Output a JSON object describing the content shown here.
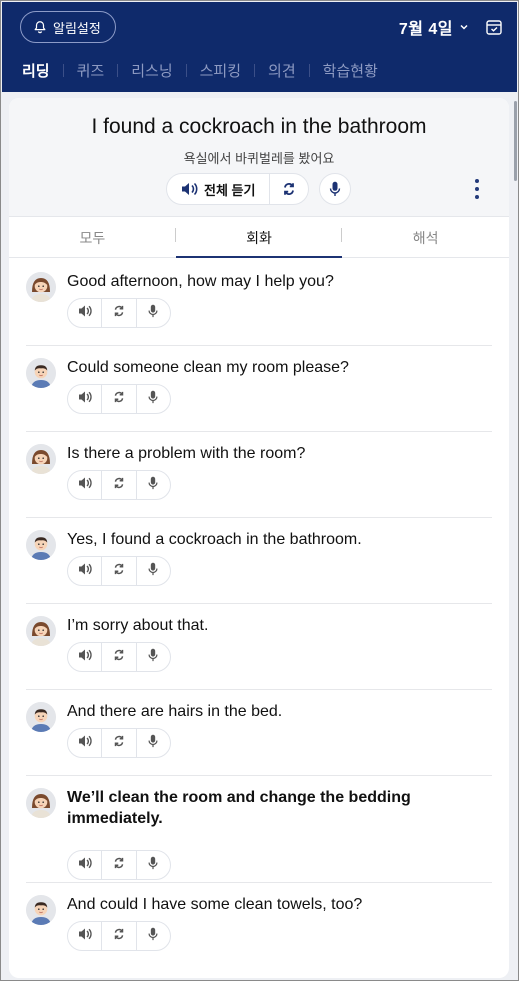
{
  "header": {
    "alarm_label": "알림설정",
    "date": "7월 4일",
    "nav": [
      {
        "label": "리딩",
        "active": true
      },
      {
        "label": "퀴즈",
        "active": false
      },
      {
        "label": "리스닝",
        "active": false
      },
      {
        "label": "스피킹",
        "active": false
      },
      {
        "label": "의견",
        "active": false
      },
      {
        "label": "학습현황",
        "active": false
      }
    ]
  },
  "sentence": {
    "english": "I found a cockroach in the bathroom",
    "korean": "욕실에서 바퀴벌레를 봤어요",
    "listen_all_label": "전체 듣기"
  },
  "tabs": [
    {
      "label": "모두",
      "active": false
    },
    {
      "label": "회화",
      "active": true
    },
    {
      "label": "해석",
      "active": false
    }
  ],
  "dialogue": [
    {
      "speaker": "woman",
      "text": "Good afternoon, how may I help you?",
      "bold": false
    },
    {
      "speaker": "man",
      "text": "Could someone clean my room please?",
      "bold": false
    },
    {
      "speaker": "woman",
      "text": "Is there a problem with the room?",
      "bold": false
    },
    {
      "speaker": "man",
      "text": "Yes, I found a cockroach in the bathroom.",
      "bold": false
    },
    {
      "speaker": "woman",
      "text": "I’m sorry about that.",
      "bold": false
    },
    {
      "speaker": "man",
      "text": "And there are hairs in the bed.",
      "bold": false
    },
    {
      "speaker": "woman",
      "text": "We’ll clean the room and change the bedding immediately.",
      "bold": true
    },
    {
      "speaker": "man",
      "text": "And could I have some clean towels, too?",
      "bold": false
    }
  ],
  "colors": {
    "header_bg": "#0f2a6b",
    "accent": "#1c3273"
  }
}
